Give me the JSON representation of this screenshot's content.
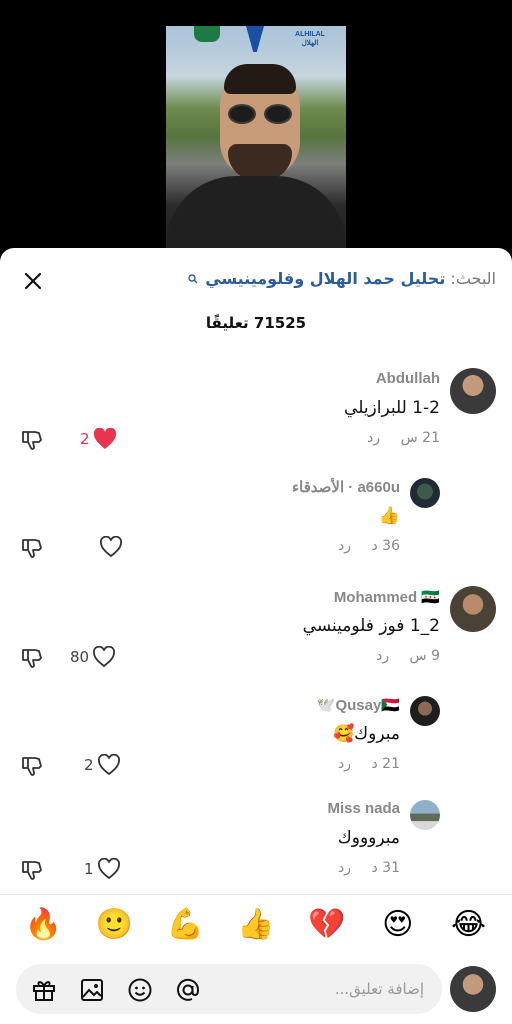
{
  "video": {
    "logo_text": "ALHILAL\nالهلال"
  },
  "search": {
    "label": "البحث:",
    "query": "تحليل حمد الهلال وفلومينيسي"
  },
  "comments_count": "71525 تعليقًا",
  "comments": [
    {
      "username": "Abdullah",
      "text": "1-2 للبرازيلي",
      "time": "21 س",
      "reply": "رد",
      "likes": "2",
      "liked": true,
      "avatar_style": "large"
    },
    {
      "username": "a660u · الأصدقاء",
      "text": "👍",
      "time": "36 د",
      "reply": "رد",
      "likes": "",
      "liked": false,
      "avatar_style": "small"
    },
    {
      "username": "Mohammed 🇸🇾",
      "text": "2_1 فوز فلومينسي",
      "time": "9 س",
      "reply": "رد",
      "likes": "80",
      "liked": false,
      "avatar_style": "large"
    },
    {
      "username": "Qusay🇸🇩🕊️",
      "text": "مبروك🥰",
      "time": "21 د",
      "reply": "رد",
      "likes": "2",
      "liked": false,
      "avatar_style": "small"
    },
    {
      "username": "Miss nada",
      "text": "مبروووك",
      "time": "31 د",
      "reply": "رد",
      "likes": "1",
      "liked": false,
      "avatar_style": "small"
    }
  ],
  "emoji_bar": [
    "😂",
    "😍",
    "💔",
    "👍",
    "💪",
    "🙂",
    "🔥"
  ],
  "composer": {
    "placeholder": "إضافة تعليق..."
  },
  "colors": {
    "like_red": "#e8344e",
    "link_blue": "#2b5d9c"
  }
}
